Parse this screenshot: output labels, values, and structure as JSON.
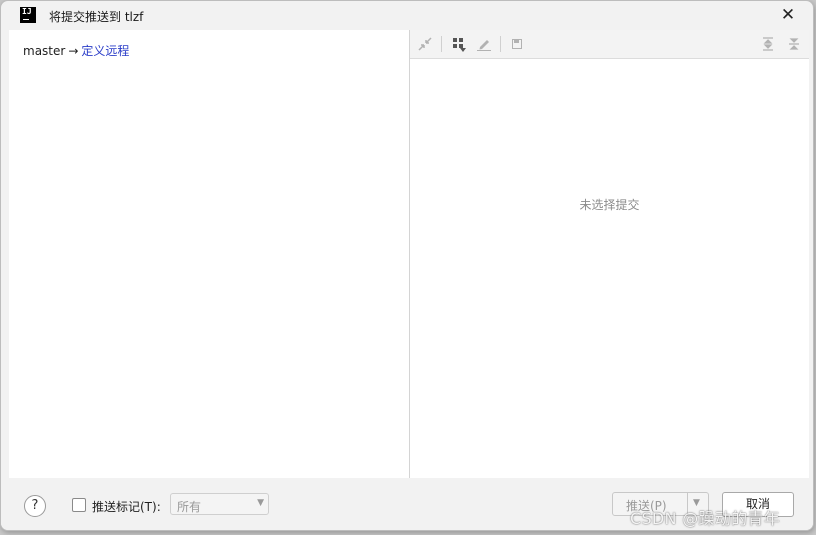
{
  "window": {
    "title": "将提交推送到 tlzf",
    "app_icon_text": "IJ"
  },
  "left": {
    "branch": "master",
    "arrow": "→",
    "remote_link": "定义远程"
  },
  "right": {
    "toolbar_icons": [
      "collapse-icon",
      "group-by-icon",
      "edit-icon",
      "save-icon",
      "expand-all-icon",
      "collapse-all-icon"
    ],
    "empty_message": "未选择提交"
  },
  "footer": {
    "help": "?",
    "push_tags_label": "推送标记(T):",
    "push_tags_select": "所有",
    "push_button": "推送(P)",
    "cancel_button": "取消"
  },
  "watermark": "CSDN @躁动的青年"
}
